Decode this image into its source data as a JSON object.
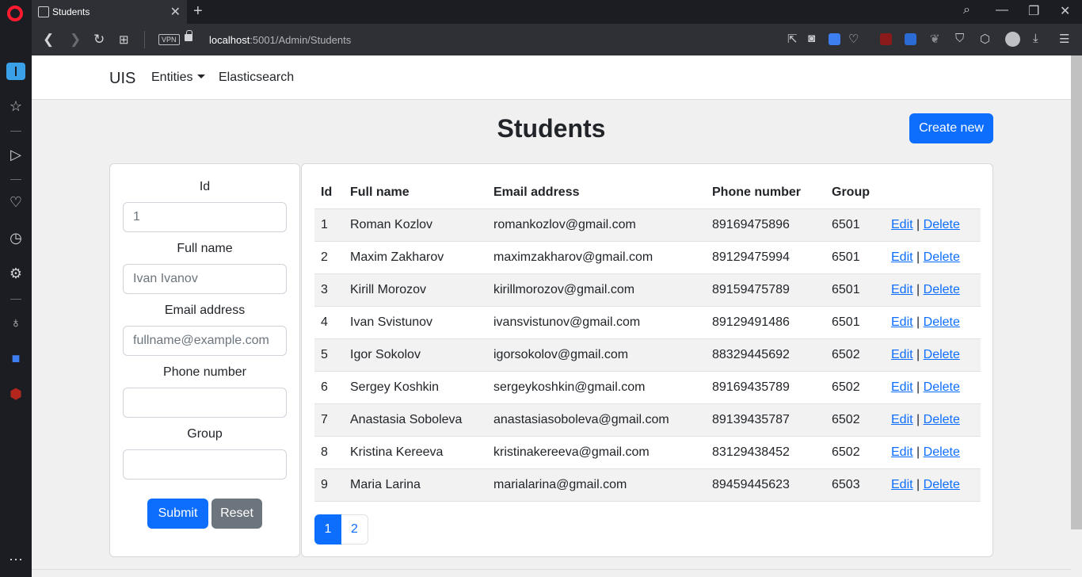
{
  "browser": {
    "tab_title": "Students",
    "url_host": "localhost",
    "url_path": ":5001/Admin/Students",
    "vpn_label": "VPN",
    "accent": "#ff1b2d"
  },
  "navbar": {
    "brand": "UIS",
    "entities": "Entities",
    "elasticsearch": "Elasticsearch"
  },
  "page": {
    "title": "Students",
    "create_label": "Create new"
  },
  "filter": {
    "id_label": "Id",
    "id_value": "1",
    "fullname_label": "Full name",
    "fullname_placeholder": "Ivan Ivanov",
    "email_label": "Email address",
    "email_placeholder": "fullname@example.com",
    "phone_label": "Phone number",
    "group_label": "Group",
    "submit_label": "Submit",
    "reset_label": "Reset"
  },
  "table": {
    "headers": [
      "Id",
      "Full name",
      "Email address",
      "Phone number",
      "Group"
    ],
    "edit_label": "Edit",
    "delete_label": "Delete",
    "separator": "|",
    "rows": [
      {
        "id": "1",
        "name": "Roman Kozlov",
        "email": "romankozlov@gmail.com",
        "phone": "89169475896",
        "group": "6501"
      },
      {
        "id": "2",
        "name": "Maxim Zakharov",
        "email": "maximzakharov@gmail.com",
        "phone": "89129475994",
        "group": "6501"
      },
      {
        "id": "3",
        "name": "Kirill Morozov",
        "email": "kirillmorozov@gmail.com",
        "phone": "89159475789",
        "group": "6501"
      },
      {
        "id": "4",
        "name": "Ivan Svistunov",
        "email": "ivansvistunov@gmail.com",
        "phone": "89129491486",
        "group": "6501"
      },
      {
        "id": "5",
        "name": "Igor Sokolov",
        "email": "igorsokolov@gmail.com",
        "phone": "88329445692",
        "group": "6502"
      },
      {
        "id": "6",
        "name": "Sergey Koshkin",
        "email": "sergeykoshkin@gmail.com",
        "phone": "89169435789",
        "group": "6502"
      },
      {
        "id": "7",
        "name": "Anastasia Soboleva",
        "email": "anastasiasoboleva@gmail.com",
        "phone": "89139435787",
        "group": "6502"
      },
      {
        "id": "8",
        "name": "Kristina Kereeva",
        "email": "kristinakereeva@gmail.com",
        "phone": "83129438452",
        "group": "6502"
      },
      {
        "id": "9",
        "name": "Maria Larina",
        "email": "marialarina@gmail.com",
        "phone": "89459445623",
        "group": "6503"
      }
    ]
  },
  "pagination": {
    "pages": [
      "1",
      "2"
    ],
    "current": "1"
  }
}
